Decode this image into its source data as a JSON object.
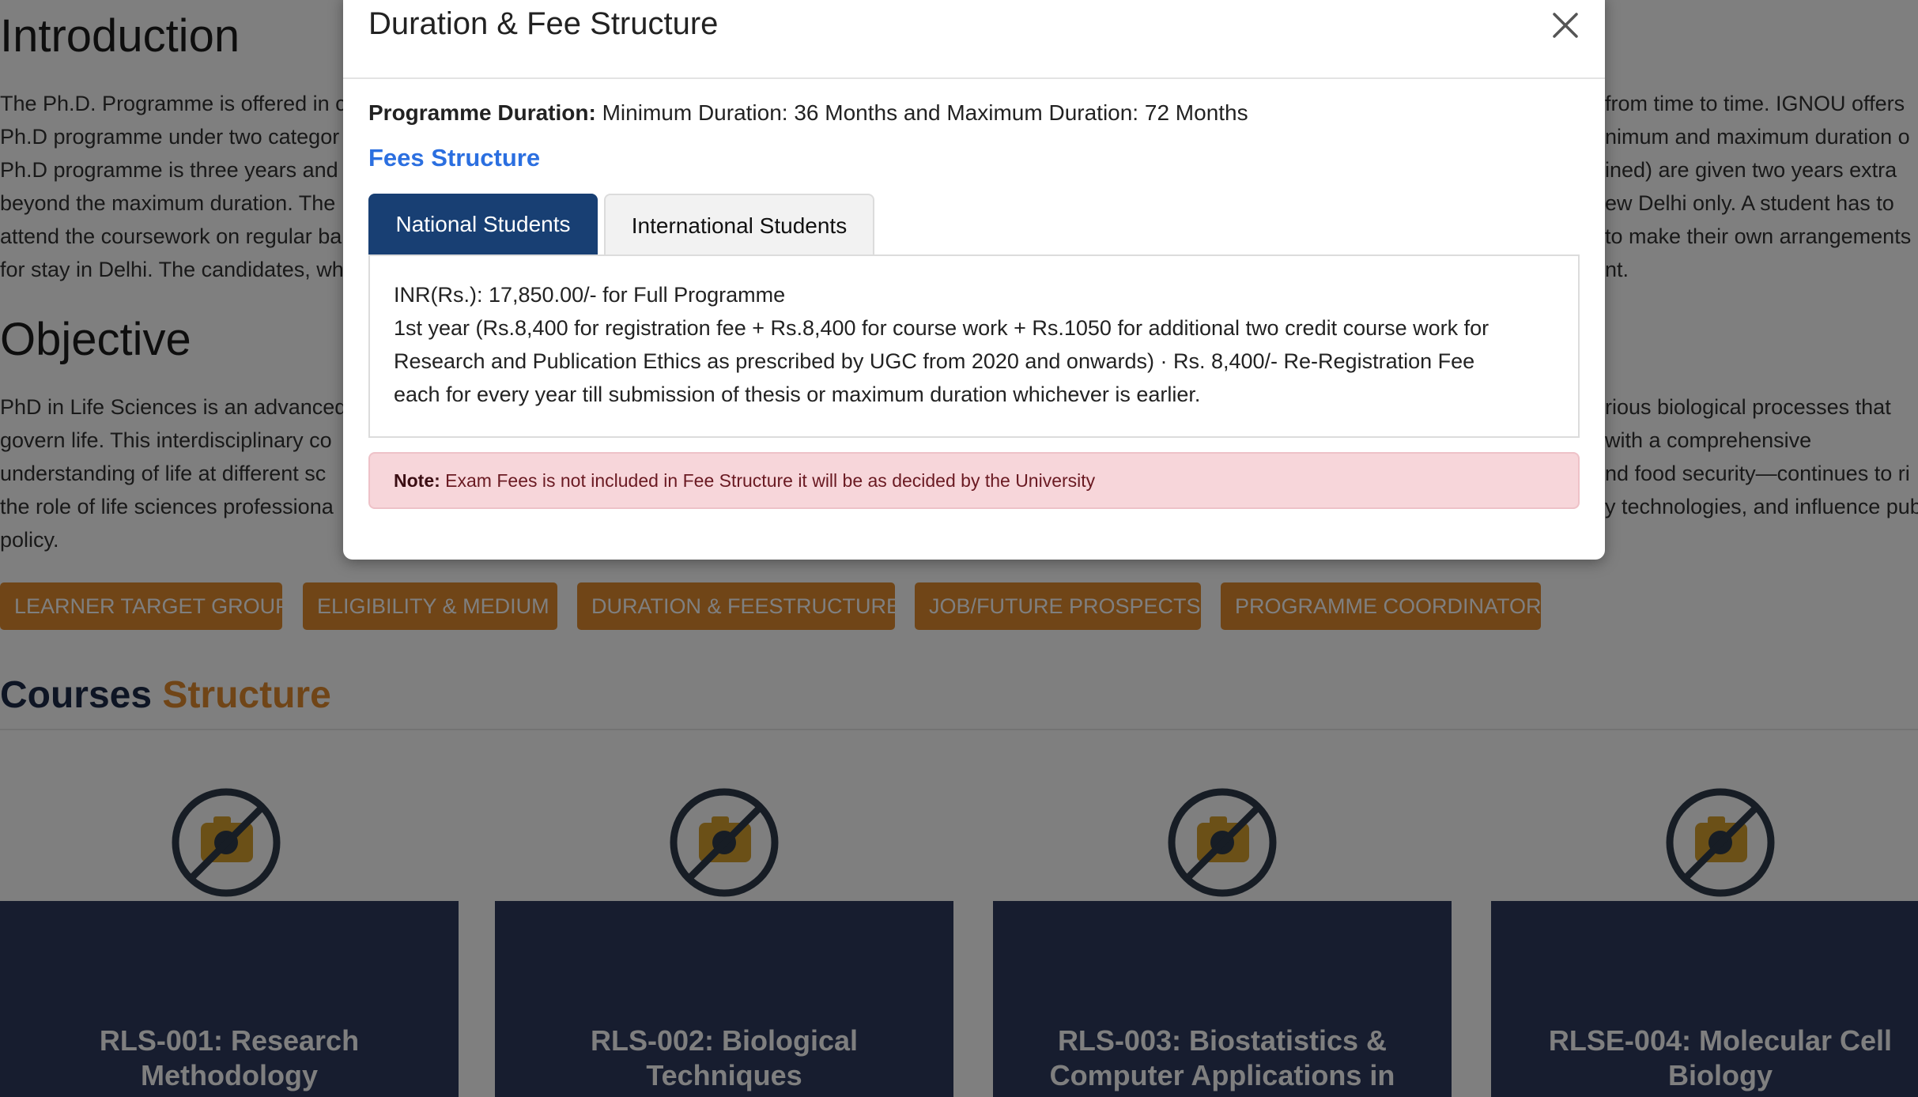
{
  "background": {
    "introduction": {
      "heading": "Introduction",
      "lines": [
        "The Ph.D. Programme is offered in c",
        "Ph.D programme under two categor",
        "Ph.D programme is three years and",
        "beyond the maximum duration. The",
        "attend the coursework on regular ba",
        "for stay in Delhi. The candidates, wh"
      ],
      "lines_right": [
        "from time to time. IGNOU offers",
        "nimum and maximum duration o",
        "ined) are given two years extra",
        "ew Delhi only. A student has to",
        "to make their own arrangements",
        "nt."
      ]
    },
    "objective": {
      "heading": "Objective",
      "lines": [
        "PhD in Life Sciences is an advanced",
        "govern life. This interdisciplinary co",
        "understanding of life at different sc",
        "the role of life sciences professiona",
        "policy."
      ],
      "lines_right": [
        "rious biological processes that",
        " with a comprehensive",
        "nd food security—continues to ri",
        "y technologies, and influence pub",
        ""
      ]
    },
    "buttons": [
      "LEARNER TARGET GROUP",
      "ELIGIBILITY & MEDIUM",
      "DURATION & FEESTRUCTURE",
      "JOB/FUTURE PROSPECTS",
      "PROGRAMME COORDINATOR"
    ],
    "courses": {
      "title_part1": "Courses",
      "title_part2": "Structure",
      "items": [
        {
          "line1": "RLS-001: Research",
          "line2": "Methodology"
        },
        {
          "line1": "RLS-002: Biological",
          "line2": "Techniques"
        },
        {
          "line1": "RLS-003: Biostatistics &",
          "line2": "Computer Applications in"
        },
        {
          "line1": "RLSE-004: Molecular Cell",
          "line2": "Biology"
        }
      ]
    }
  },
  "modal": {
    "title": "Duration & Fee Structure",
    "duration_label": "Programme Duration:",
    "duration_value": "Minimum Duration: 36 Months and Maximum Duration: 72 Months",
    "fees_heading": "Fees Structure",
    "tabs": [
      {
        "label": "National Students",
        "active": true
      },
      {
        "label": "International Students",
        "active": false
      }
    ],
    "national_content": [
      "INR(Rs.): 17,850.00/- for Full Programme",
      "1st year (Rs.8,400 for  registration fee + Rs.8,400 for course work  + Rs.1050 for additional two credit course  work for",
      "Research and Publication Ethics as  prescribed by UGC from 2020 and  onwards)  ·  Rs. 8,400/- Re-Registration Fee",
      "each for  every year till submission of thesis or  maximum duration whichever is earlier."
    ],
    "note_label": "Note:",
    "note_text": "Exam Fees is not included in Fee Structure it will be as decided by the University"
  },
  "colors": {
    "accent_orange": "#e08a2e",
    "navy": "#183f73",
    "fees_blue": "#2b6fe0",
    "card_bg": "#2f3b5e",
    "note_bg": "#f7d6da"
  }
}
